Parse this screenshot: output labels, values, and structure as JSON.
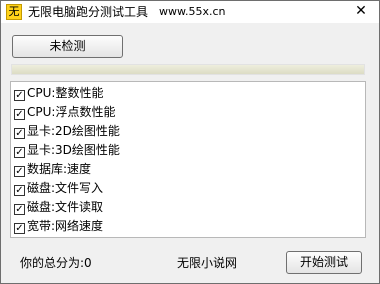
{
  "titlebar": {
    "icon_glyph": "无",
    "title": "无限电脑跑分测试工具",
    "url": "www.55x.cn",
    "close_glyph": "✕"
  },
  "status": {
    "button_label": "未检测"
  },
  "progress": {
    "percent": 0
  },
  "tests": {
    "check_glyph": "✓",
    "items": [
      {
        "label": "CPU:整数性能",
        "checked": true
      },
      {
        "label": "CPU:浮点数性能",
        "checked": true
      },
      {
        "label": "显卡:2D绘图性能",
        "checked": true
      },
      {
        "label": "显卡:3D绘图性能",
        "checked": true
      },
      {
        "label": "数据库:速度",
        "checked": true
      },
      {
        "label": "磁盘:文件写入",
        "checked": true
      },
      {
        "label": "磁盘:文件读取",
        "checked": true
      },
      {
        "label": "宽带:网络速度",
        "checked": true
      }
    ]
  },
  "footer": {
    "score_text": "你的总分为:0",
    "brand": "无限小说网",
    "start_label": "开始测试"
  },
  "colors": {
    "icon_bg": "#ffd21a",
    "progress_track": "#dcdcc4"
  }
}
